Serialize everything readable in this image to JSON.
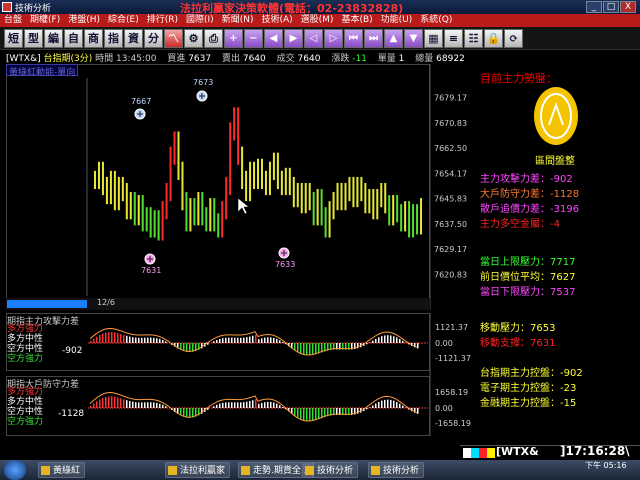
{
  "window": {
    "title": "技術分析",
    "marquee": "法拉利贏家決策軟體(電話：02-23832828)",
    "buttons": [
      "_",
      "□",
      "X"
    ]
  },
  "menu": [
    "台盤",
    "期權(F)",
    "港盤(H)",
    "綜合(E)",
    "排行(R)",
    "國際(I)",
    "新聞(N)",
    "技術(A)",
    "選股(M)",
    "基本(B)",
    "功能(U)",
    "系統(Q)"
  ],
  "toolbar": {
    "text_tools": [
      "短",
      "型",
      "編",
      "自",
      "商",
      "指",
      "資",
      "分"
    ],
    "icon_tools": [
      "chart-icon",
      "settings-icon",
      "print-icon",
      "plus-icon",
      "minus-icon",
      "arrow-left-icon",
      "arrow-right-icon",
      "left-icon",
      "right-icon",
      "first-icon",
      "last-icon",
      "up-icon",
      "down-icon",
      "grid-icon",
      "link-icon",
      "list-icon",
      "lock-icon",
      "refresh-icon"
    ]
  },
  "chart_header": {
    "symbol": "[WTX&]",
    "name": "台指期(3分)",
    "time_label": "時間",
    "time": "13:45:00",
    "buy_label": "買進",
    "buy": "7637",
    "sell_label": "賣出",
    "sell": "7640",
    "deal_label": "成交",
    "deal": "7640",
    "change_label": "漲跌",
    "change": "-11",
    "vol_label": "單量",
    "vol": "1",
    "total_label": "總量",
    "total": "68922"
  },
  "chart_tag": "黃綠紅動能-單向",
  "chart_date": "12/6",
  "chart_data": {
    "type": "bar",
    "ylim": [
      7615,
      7685
    ],
    "ytick_labels": [
      "7679.17",
      "7670.83",
      "7662.50",
      "7654.17",
      "7645.83",
      "7637.50",
      "7629.17",
      "7620.83"
    ],
    "annotations": [
      {
        "label": "7667",
        "kind": "high"
      },
      {
        "label": "7673",
        "kind": "high"
      },
      {
        "label": "7631",
        "kind": "low"
      },
      {
        "label": "7633",
        "kind": "low"
      }
    ],
    "values": [
      7652,
      7655,
      7650,
      7647,
      7652,
      7645,
      7650,
      7648,
      7642,
      7645,
      7640,
      7644,
      7638,
      7640,
      7636,
      7639,
      7635,
      7642,
      7648,
      7660,
      7665,
      7655,
      7645,
      7638,
      7643,
      7640,
      7645,
      7640,
      7638,
      7643,
      7638,
      7636,
      7642,
      7650,
      7668,
      7673,
      7660,
      7652,
      7648,
      7655,
      7652,
      7656,
      7652,
      7650,
      7655,
      7658,
      7652,
      7650,
      7653,
      7650,
      7646,
      7648,
      7644,
      7648,
      7645,
      7640,
      7646,
      7640,
      7636,
      7642,
      7645,
      7648,
      7645,
      7648,
      7650,
      7646,
      7650,
      7648,
      7644,
      7646,
      7642,
      7646,
      7648,
      7644,
      7640,
      7644,
      7641,
      7638,
      7642,
      7636,
      7641,
      7637,
      7643
    ]
  },
  "sub1": {
    "title": "期指主力攻擊力差",
    "legend": [
      {
        "label": "多方強力",
        "color": "#ff3333"
      },
      {
        "label": "多方中性",
        "color": "#ffffff"
      },
      {
        "label": "空方中性",
        "color": "#ffffff"
      },
      {
        "label": "空方強力",
        "color": "#33dd33"
      }
    ],
    "value": "-902",
    "yticks": [
      "1121.37",
      "0.00",
      "-1121.37"
    ]
  },
  "sub2": {
    "title": "期指大戶防守力差",
    "legend": [
      {
        "label": "多方強力",
        "color": "#ff3333"
      },
      {
        "label": "多方中性",
        "color": "#ffffff"
      },
      {
        "label": "空方中性",
        "color": "#ffffff"
      },
      {
        "label": "空方強力",
        "color": "#33dd33"
      }
    ],
    "value": "-1128",
    "yticks": [
      "1658.19",
      "0.00",
      "-1658.19"
    ]
  },
  "right": {
    "title": "目前主力勢盤：",
    "badge": "區間盤整",
    "rows": [
      {
        "text": "主力攻擊力差：-902",
        "color": "#ff44ff"
      },
      {
        "text": "大戶防守力差：-1128",
        "color": "#ff7733"
      },
      {
        "text": "散戶追價力差：-3196",
        "color": "#ff44ff"
      },
      {
        "text": "主力多空金屬：-4",
        "color": "#ff2222"
      },
      {
        "text": "當日上限壓力：7717",
        "color": "#33ff33"
      },
      {
        "text": "前日價位平均：7627",
        "color": "#ffff33"
      },
      {
        "text": "當日下限壓力：7537",
        "color": "#ff44ff"
      },
      {
        "text": "移動壓力：7653",
        "color": "#ffff33"
      },
      {
        "text": "移動支撐：7631",
        "color": "#ff2222"
      },
      {
        "text": "台指期主力控盤：-902",
        "color": "#ffff33"
      },
      {
        "text": "電子期主力控盤：-23",
        "color": "#ffff33"
      },
      {
        "text": "金融期主力控盤：-15",
        "color": "#ffff33"
      }
    ]
  },
  "ticker": {
    "symbol": "[WTX&",
    "time": "]17:16:28\\"
  },
  "taskbar": {
    "tasks": [
      "黃綠紅",
      "法拉利贏家",
      "走勢.期貨全...",
      "技術分析",
      "技術分析"
    ],
    "clock_time": "下午 05:16"
  }
}
